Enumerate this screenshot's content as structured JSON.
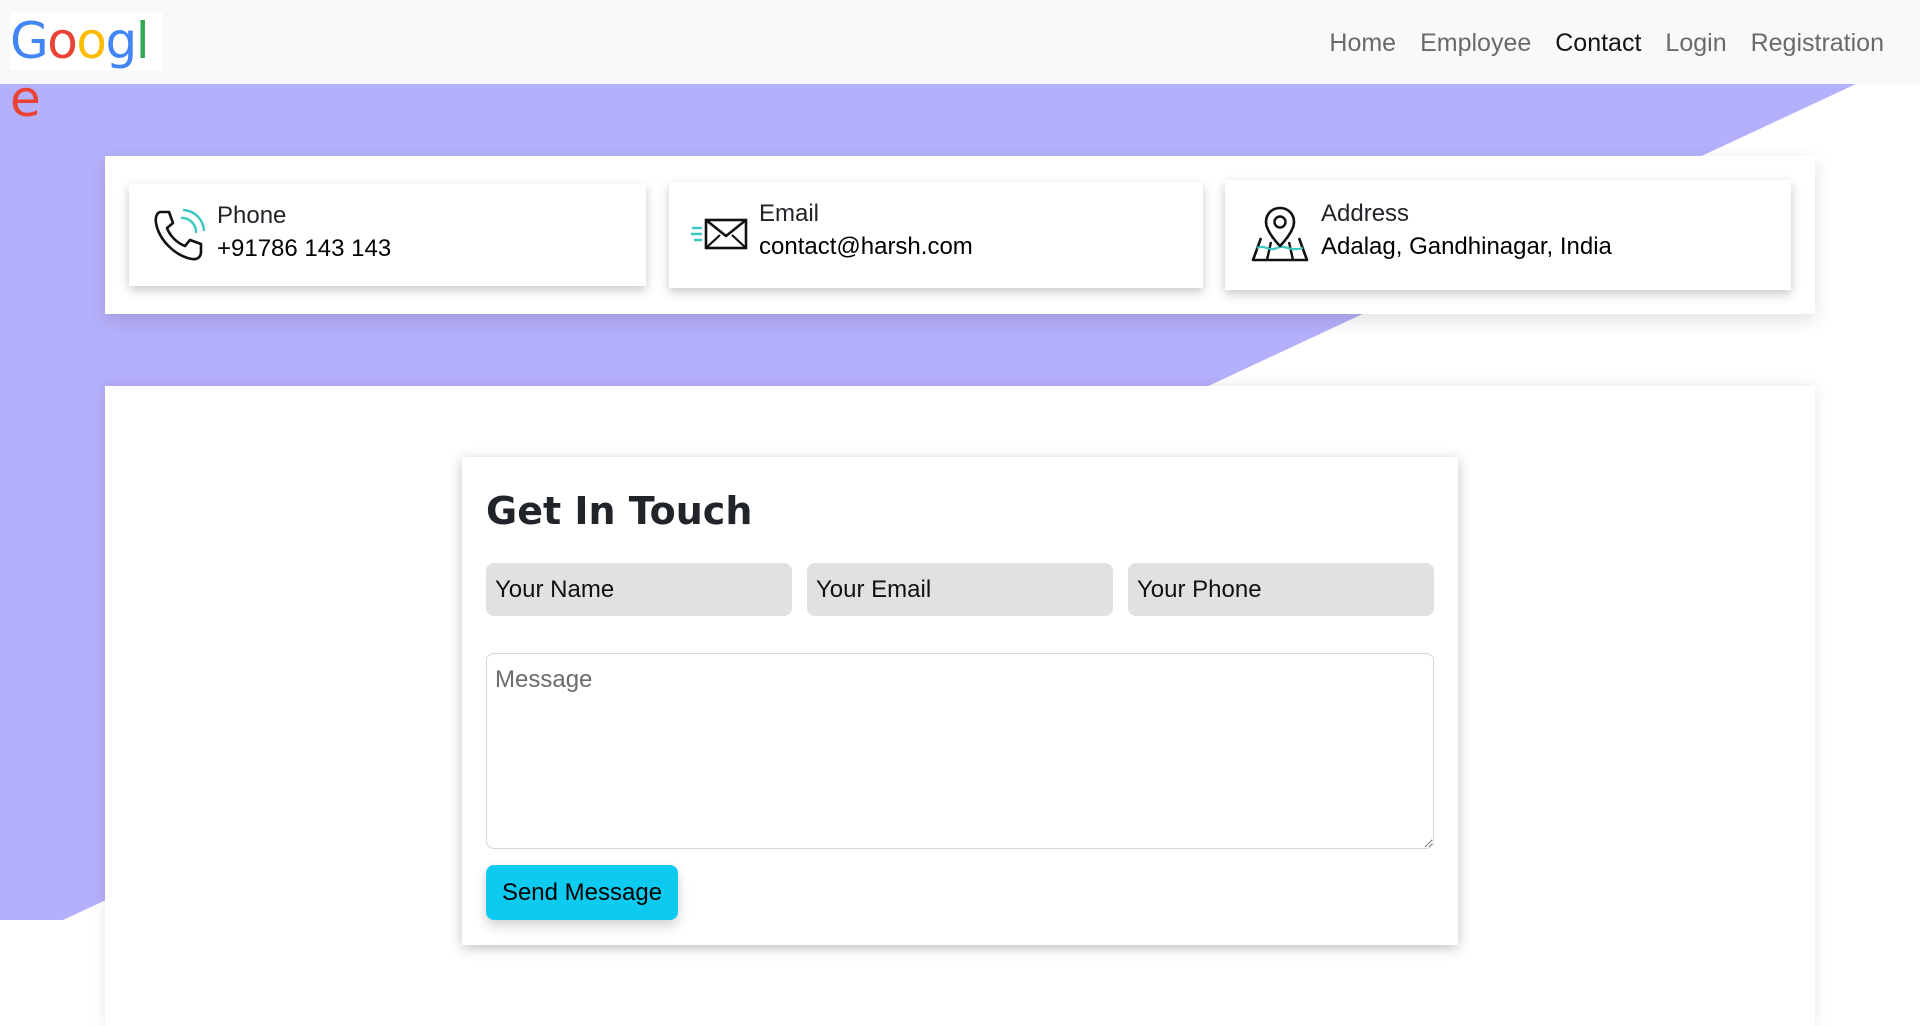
{
  "brand": {
    "letters": [
      "G",
      "o",
      "o",
      "g",
      "l",
      "e"
    ],
    "colors": [
      "#4285F4",
      "#EA4335",
      "#FBBC05",
      "#4285F4",
      "#34A853",
      "#EA4335"
    ]
  },
  "nav": {
    "items": [
      {
        "label": "Home"
      },
      {
        "label": "Employee"
      },
      {
        "label": "Contact",
        "active": true
      },
      {
        "label": "Login"
      },
      {
        "label": "Registration"
      }
    ]
  },
  "contact_info": {
    "phone": {
      "title": "Phone",
      "value": "+91786 143 143",
      "icon": "phone-icon"
    },
    "email": {
      "title": "Email",
      "value": "contact@harsh.com",
      "icon": "envelope-icon"
    },
    "address": {
      "title": "Address",
      "value": "Adalag, Gandhinagar, India",
      "icon": "map-pin-icon"
    }
  },
  "form": {
    "title": "Get In Touch",
    "name_placeholder": "Your Name",
    "email_placeholder": "Your Email",
    "phone_placeholder": "Your Phone",
    "message_placeholder": "Message",
    "submit_label": "Send Message"
  },
  "colors": {
    "background_accent": "#b5b0fb",
    "button": "#0dcaf0",
    "icon_accent": "#3cc8c0"
  }
}
